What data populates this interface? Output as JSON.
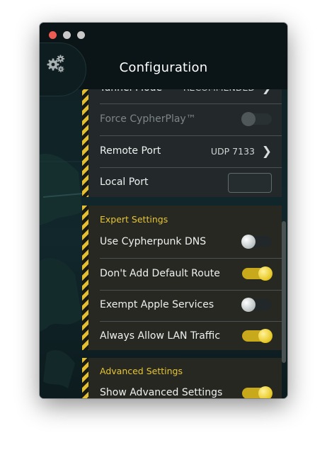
{
  "window": {
    "title": "Configuration"
  },
  "header": {
    "title": "Configuration",
    "settings_icon": "gears-icon"
  },
  "connection": {
    "tunnel_mode": {
      "label": "Tunnel Mode",
      "value": "RECOMMENDED"
    },
    "force_cypherplay": {
      "label": "Force CypherPlay™",
      "enabled": false,
      "disabled": true
    },
    "remote_port": {
      "label": "Remote Port",
      "value": "UDP 7133"
    },
    "local_port": {
      "label": "Local Port",
      "value": ""
    }
  },
  "expert": {
    "title": "Expert Settings",
    "items": [
      {
        "label": "Use Cypherpunk DNS",
        "on": false
      },
      {
        "label": "Don't Add Default Route",
        "on": true
      },
      {
        "label": "Exempt Apple Services",
        "on": false
      },
      {
        "label": "Always Allow LAN Traffic",
        "on": true
      }
    ]
  },
  "advanced": {
    "title": "Advanced Settings",
    "show_advanced": {
      "label": "Show Advanced Settings",
      "on": true
    }
  },
  "colors": {
    "accent": "#e6c536",
    "toggle_on": "#c8a91c",
    "close": "#ee5b53"
  }
}
